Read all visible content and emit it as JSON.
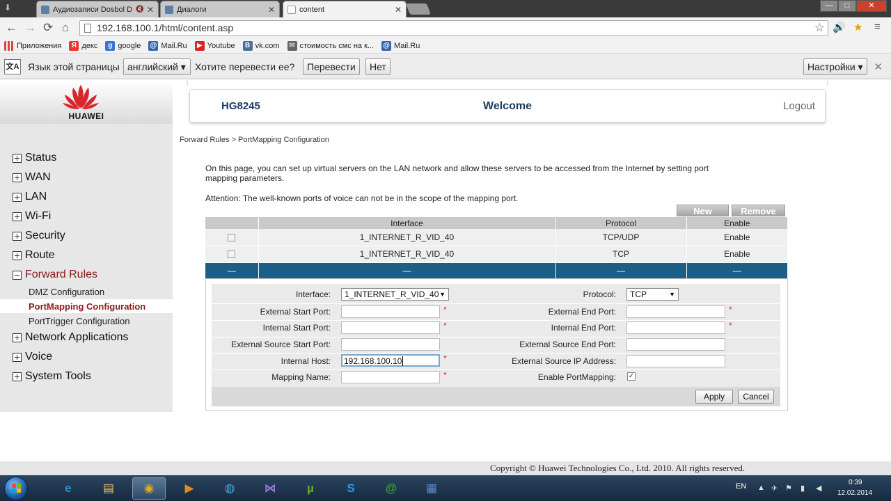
{
  "browser": {
    "tabs": [
      {
        "label": "Аудиозаписи Dosbol D",
        "favicon_color": "#5b7fa6",
        "muted_icon": "🔇",
        "active": false
      },
      {
        "label": "Диалоги",
        "favicon_color": "#5b7fa6",
        "active": false
      },
      {
        "label": "content",
        "favicon_color": "#ffffff",
        "active": true
      }
    ],
    "tab_close_glyph": "✕",
    "window_buttons": {
      "minimize": "—",
      "maximize": "□",
      "close": "✕"
    },
    "nav": {
      "back": "←",
      "forward": "→",
      "reload": "⟳",
      "home": "⌂"
    },
    "url": "192.168.100.1/html/content.asp",
    "star_glyph": "☆",
    "extension_glyphs": [
      "🔊",
      "★",
      "≡"
    ],
    "bookmarks": [
      {
        "label": "Приложения",
        "icon": "apps-icon",
        "color": "#d44"
      },
      {
        "label": "декс",
        "icon": "yandex-icon",
        "color": "#e33",
        "glyph": "Я"
      },
      {
        "label": "google",
        "icon": "google-icon",
        "color": "#3b74d8",
        "glyph": "g"
      },
      {
        "label": "Mail.Ru",
        "icon": "mailru-icon",
        "color": "#3566a8",
        "glyph": "@"
      },
      {
        "label": "Youtube",
        "icon": "youtube-icon",
        "color": "#d22",
        "glyph": "▶"
      },
      {
        "label": "vk.com",
        "icon": "vk-icon",
        "color": "#4a6f9c",
        "glyph": "B"
      },
      {
        "label": "стоимость смс на к...",
        "icon": "sms-icon",
        "color": "#666",
        "glyph": "✉"
      },
      {
        "label": "Mail.Ru",
        "icon": "mailru-icon",
        "color": "#3566a8",
        "glyph": "@"
      }
    ],
    "translate_bar": {
      "prompt": "Язык этой страницы",
      "language": "английский",
      "question": "Хотите перевести ее?",
      "translate_btn": "Перевести",
      "no_btn": "Нет",
      "settings_btn": "Настройки",
      "close": "✕"
    }
  },
  "router": {
    "brand": "HUAWEI",
    "model": "HG8245",
    "welcome": "Welcome",
    "logout": "Logout",
    "menu": [
      {
        "label": "Status",
        "open": false
      },
      {
        "label": "WAN",
        "open": false
      },
      {
        "label": "LAN",
        "open": false
      },
      {
        "label": "Wi-Fi",
        "open": false
      },
      {
        "label": "Security",
        "open": false
      },
      {
        "label": "Route",
        "open": false
      },
      {
        "label": "Forward Rules",
        "open": true
      },
      {
        "label": "Network Applications",
        "open": false
      },
      {
        "label": "Voice",
        "open": false
      },
      {
        "label": "System Tools",
        "open": false
      }
    ],
    "submenu": [
      "DMZ Configuration",
      "PortMapping Configuration",
      "PortTrigger Configuration"
    ],
    "breadcrumb": "Forward Rules > PortMapping Configuration",
    "intro": "On this page, you can set up virtual servers on the LAN network and allow these servers to be accessed from the Internet by setting port mapping parameters.",
    "attention": "Attention: The well-known ports of voice can not be in the scope of the mapping port.",
    "buttons": {
      "new": "New",
      "remove": "Remove"
    },
    "table": {
      "headers": [
        "",
        "Interface",
        "Protocol",
        "Enable"
      ],
      "rows": [
        [
          "",
          "1_INTERNET_R_VID_40",
          "TCP/UDP",
          "Enable"
        ],
        [
          "",
          "1_INTERNET_R_VID_40",
          "TCP",
          "Enable"
        ]
      ],
      "selected_row": [
        "—",
        "—",
        "—",
        "—"
      ]
    },
    "form": {
      "interface_label": "Interface:",
      "interface_value": "1_INTERNET_R_VID_40",
      "protocol_label": "Protocol:",
      "protocol_value": "TCP",
      "ext_start_label": "External Start Port:",
      "ext_end_label": "External End Port:",
      "int_start_label": "Internal Start Port:",
      "int_end_label": "Internal End Port:",
      "src_start_label": "External Source Start Port:",
      "src_end_label": "External Source End Port:",
      "host_label": "Internal Host:",
      "host_value": "192.168.100.10",
      "src_ip_label": "External Source IP Address:",
      "name_label": "Mapping Name:",
      "enable_label": "Enable PortMapping:",
      "enable_checked": "✓",
      "required_mark": "*",
      "apply": "Apply",
      "cancel": "Cancel"
    },
    "copyright": "Copyright © Huawei Technologies Co., Ltd. 2010. All rights reserved."
  },
  "taskbar": {
    "apps": [
      {
        "name": "internet-explorer-icon",
        "glyph": "e",
        "color": "#2b8fd6"
      },
      {
        "name": "file-explorer-icon",
        "glyph": "▤",
        "color": "#e4c26b"
      },
      {
        "name": "chrome-icon",
        "glyph": "◉",
        "color": "#e0a823",
        "active": true
      },
      {
        "name": "media-player-icon",
        "glyph": "▶",
        "color": "#e38a20"
      },
      {
        "name": "network-icon",
        "glyph": "◍",
        "color": "#49a4e0"
      },
      {
        "name": "visual-studio-icon",
        "glyph": "⋈",
        "color": "#7a58c4"
      },
      {
        "name": "utorrent-icon",
        "glyph": "µ",
        "color": "#6aae2e"
      },
      {
        "name": "skype-icon",
        "glyph": "S",
        "color": "#1fa3e0"
      },
      {
        "name": "mail-agent-icon",
        "glyph": "@",
        "color": "#3aa33a"
      },
      {
        "name": "control-panel-icon",
        "glyph": "▦",
        "color": "#5b8bc4"
      }
    ],
    "lang": "EN",
    "time": "0:39",
    "date": "12.02.2014"
  }
}
